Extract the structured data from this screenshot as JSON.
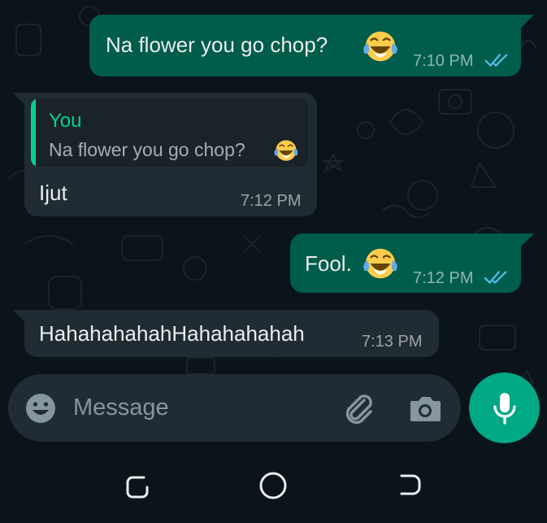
{
  "messages": [
    {
      "direction": "outgoing",
      "text": "Na flower you go chop?",
      "emoji": "face-with-tears-of-joy",
      "time": "7:10 PM",
      "status": "read"
    },
    {
      "direction": "incoming",
      "reply_to": {
        "author": "You",
        "text": "Na flower you go chop?",
        "emoji": "face-with-tears-of-joy"
      },
      "text": "Ijut",
      "time": "7:12 PM"
    },
    {
      "direction": "outgoing",
      "text": "Fool.",
      "emoji": "face-with-tears-of-joy",
      "time": "7:12 PM",
      "status": "read"
    },
    {
      "direction": "incoming",
      "text": "HahahahahahHahahahahah",
      "time": "7:13 PM"
    }
  ],
  "composer": {
    "placeholder": "Message",
    "icons": [
      "emoji-icon",
      "attach-icon",
      "camera-icon"
    ],
    "send_button_icon": "mic-icon"
  },
  "navbar": {
    "icons": [
      "recents-icon",
      "home-icon",
      "back-icon"
    ]
  },
  "colors": {
    "background": "#0b141a",
    "outgoing_bubble": "#005c4b",
    "incoming_bubble": "#202c33",
    "accent": "#00a884",
    "quote_author": "#06cf9c",
    "read_ticks": "#53bdeb"
  }
}
